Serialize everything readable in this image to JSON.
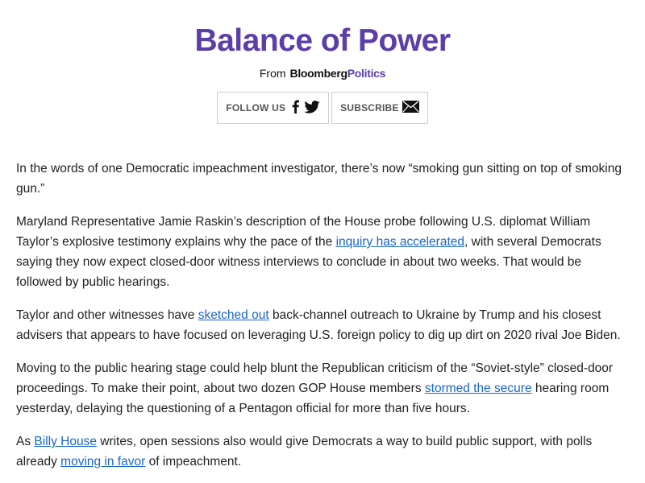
{
  "header": {
    "title": "Balance of Power",
    "from_label": "From",
    "brand_part1": "Bloomberg",
    "brand_part2": "Politics",
    "follow_label": "FOLLOW US",
    "subscribe_label": "SUBSCRIBE"
  },
  "colors": {
    "title_purple": "#5b3ea8",
    "link_blue": "#1a66c8",
    "body_text": "#222222"
  },
  "icons": {
    "facebook": "facebook-icon",
    "twitter": "twitter-icon",
    "mail": "mail-icon"
  },
  "paragraphs": {
    "p1": {
      "text": "In the words of one Democratic impeachment investigator, there’s now “smoking gun sitting on top of smoking gun.”"
    },
    "p2": {
      "before": "Maryland Representative Jamie Raskin’s description of the House probe following U.S. diplomat William Taylor’s explosive testimony explains why the pace of the ",
      "link": "inquiry has accelerated",
      "after": ", with several Democrats saying they now expect closed-door witness interviews to conclude in about two weeks. That would be followed by public hearings."
    },
    "p3": {
      "before": "Taylor and other witnesses have ",
      "link": "sketched out",
      "after": " back-channel outreach to Ukraine by Trump and his closest advisers that appears to have focused on leveraging U.S. foreign policy to dig up dirt on 2020 rival Joe Biden."
    },
    "p4": {
      "before": "Moving to the public hearing stage could help blunt the Republican criticism of the “Soviet-style” closed-door proceedings. To make their point, about two dozen GOP House members ",
      "link": "stormed the secure",
      "after": " hearing room yesterday, delaying the questioning of a Pentagon official for more than five hours."
    },
    "p5": {
      "before": "As ",
      "link1": "Billy House",
      "middle": " writes, open sessions also would give Democrats a way to build public support, with polls already ",
      "link2": "moving in favor",
      "after": " of impeachment."
    }
  }
}
